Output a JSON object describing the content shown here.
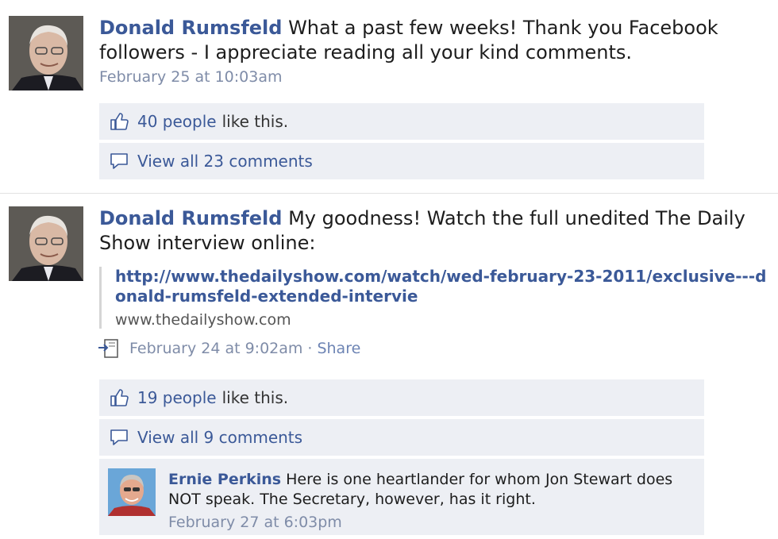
{
  "posts": [
    {
      "author": "Donald Rumsfeld",
      "message": "What a past few weeks! Thank you Facebook followers - I appreciate reading all your kind comments.",
      "timestamp": "February 25 at 10:03am",
      "likes_count": "40 people",
      "likes_suffix": "like this.",
      "view_comments": "View all 23 comments"
    },
    {
      "author": "Donald Rumsfeld",
      "message": "My goodness! Watch the full unedited The Daily Show interview online:",
      "attachment": {
        "link": "http://www.thedailyshow.com/watch/wed-february-23-2011/exclusive---donald-rumsfeld-extended-intervie",
        "domain": "www.thedailyshow.com"
      },
      "timestamp": "February 24 at 9:02am",
      "separator": "·",
      "share_label": "Share",
      "likes_count": "19 people",
      "likes_suffix": "like this.",
      "view_comments": "View all 9 comments",
      "comment": {
        "author": "Ernie Perkins",
        "text": "Here is one heartlander for whom Jon Stewart does NOT speak. The Secretary, however, has it right.",
        "timestamp": "February 27 at 6:03pm"
      }
    }
  ],
  "icons": {
    "like": "thumbs-up-icon",
    "comment": "speech-bubble-icon",
    "link": "link-attachment-icon"
  },
  "colors": {
    "link": "#3b5998",
    "ufi_bg": "#edeff4",
    "timestamp": "#7f8ca8"
  }
}
